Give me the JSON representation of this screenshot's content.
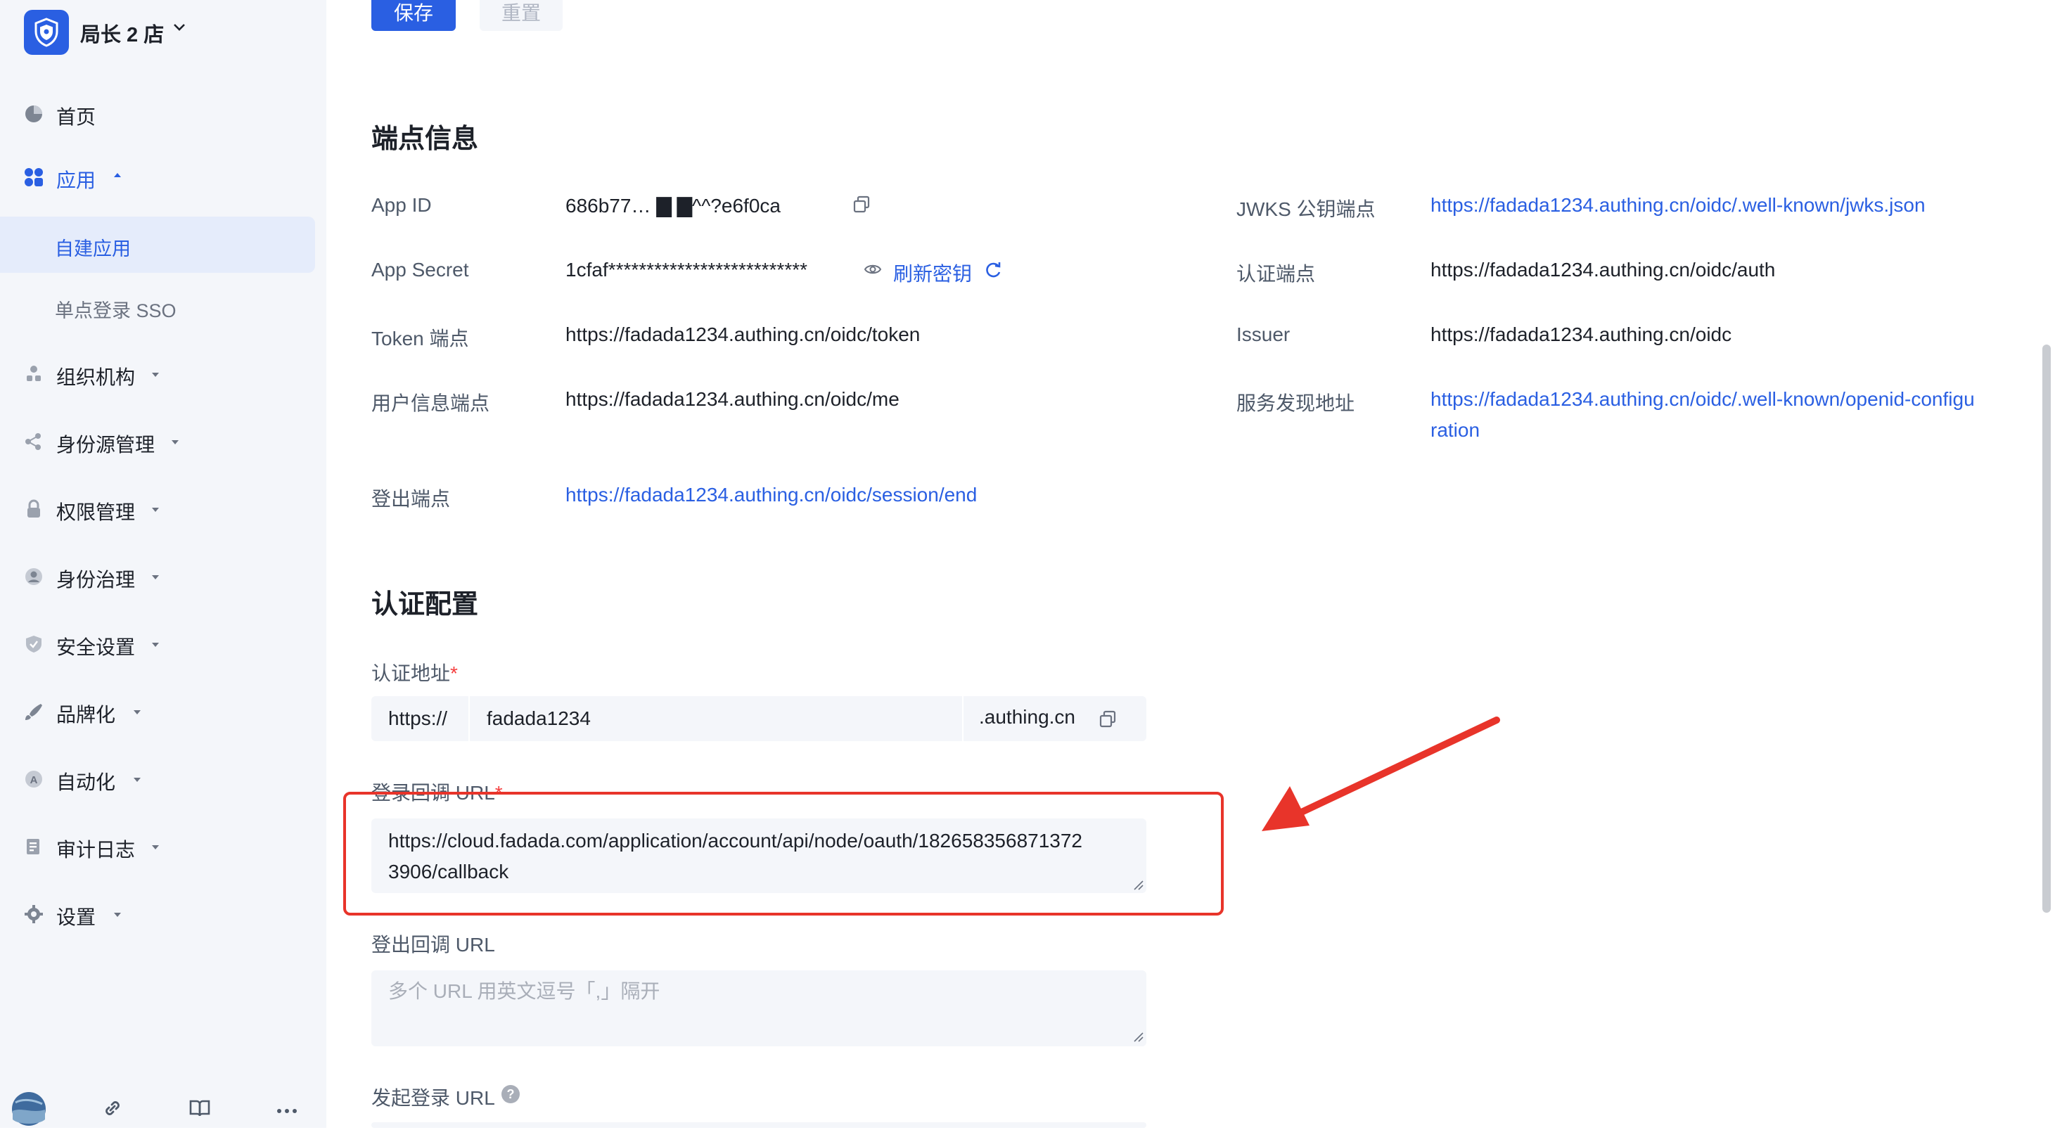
{
  "sidebar": {
    "brand": "局长 2 店",
    "nav": [
      {
        "label": "首页",
        "icon": "pie-chart-icon"
      },
      {
        "label": "应用",
        "icon": "apps-icon",
        "expanded": true,
        "children": [
          {
            "label": "自建应用",
            "active": true
          },
          {
            "label": "单点登录 SSO",
            "active": false
          }
        ]
      },
      {
        "label": "组织机构",
        "icon": "org-icon"
      },
      {
        "label": "身份源管理",
        "icon": "share-icon"
      },
      {
        "label": "权限管理",
        "icon": "lock-icon"
      },
      {
        "label": "身份治理",
        "icon": "user-icon"
      },
      {
        "label": "安全设置",
        "icon": "shield-icon"
      },
      {
        "label": "品牌化",
        "icon": "brush-icon"
      },
      {
        "label": "自动化",
        "icon": "automation-icon"
      },
      {
        "label": "审计日志",
        "icon": "log-icon"
      },
      {
        "label": "设置",
        "icon": "gear-icon"
      }
    ],
    "bottom_icons": [
      "avatar",
      "link-icon",
      "book-icon",
      "more-icon"
    ]
  },
  "toolbar": {
    "save_label": "保存",
    "reset_label": "重置"
  },
  "endpoints": {
    "title": "端点信息",
    "left": [
      {
        "label": "App ID",
        "value": "686b77…  ▇   ▇^^?e6f0ca",
        "copy": true
      },
      {
        "label": "App Secret",
        "value": "1cfaf**************************",
        "refresh_label": "刷新密钥"
      },
      {
        "label": "Token 端点",
        "value": "https://fadada1234.authing.cn/oidc/token"
      },
      {
        "label": "用户信息端点",
        "value": "https://fadada1234.authing.cn/oidc/me"
      },
      {
        "label": "登出端点",
        "value": "https://fadada1234.authing.cn/oidc/session/end",
        "is_link": true
      }
    ],
    "right": [
      {
        "label": "JWKS 公钥端点",
        "value": "https://fadada1234.authing.cn/oidc/.well-known/jwks.json",
        "is_link": true
      },
      {
        "label": "认证端点",
        "value": "https://fadada1234.authing.cn/oidc/auth"
      },
      {
        "label": "Issuer",
        "value": "https://fadada1234.authing.cn/oidc"
      },
      {
        "label": "服务发现地址",
        "value_line1": "https://fadada1234.authing.cn/oidc/.well-known/openid-configu",
        "value_line2": "ration",
        "is_link": true
      }
    ]
  },
  "auth_config": {
    "title": "认证配置",
    "auth_address": {
      "label": "认证地址",
      "required": "*",
      "prefix": "https://",
      "value": "fadada1234",
      "suffix": ".authing.cn"
    },
    "login_callback": {
      "label": "登录回调 URL",
      "required": "*",
      "value_line1": "https://cloud.fadada.com/application/account/api/node/oauth/182658356871372",
      "value_line2": "3906/callback"
    },
    "logout_callback": {
      "label": "登出回调 URL",
      "placeholder": "多个 URL 用英文逗号「,」隔开"
    },
    "initiate_login": {
      "label": "发起登录 URL"
    }
  },
  "colors": {
    "primary": "#2a5fe2",
    "annotation": "#e8342a",
    "sidebar_bg": "#f4f6fa"
  }
}
